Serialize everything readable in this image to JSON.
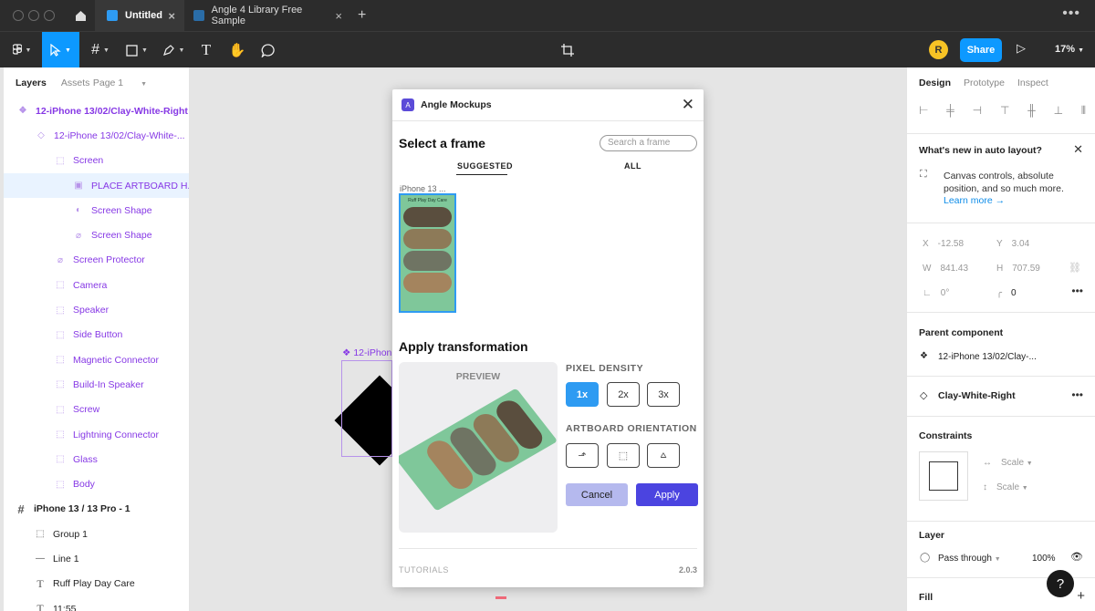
{
  "tabs": [
    {
      "label": "Untitled"
    },
    {
      "label": "Angle 4 Library Free Sample"
    }
  ],
  "toolbar": {
    "avatar": "R",
    "share": "Share",
    "zoom": "17%"
  },
  "left": {
    "tab_layers": "Layers",
    "tab_assets": "Assets",
    "page": "Page 1",
    "layers": [
      "12-iPhone 13/02/Clay-White-Right",
      "12-iPhone 13/02/Clay-White-...",
      "Screen",
      "PLACE ARTBOARD H...",
      "Screen Shape",
      "Screen Shape",
      "Screen Protector",
      "Camera",
      "Speaker",
      "Side Button",
      "Magnetic Connector",
      "Build-In Speaker",
      "Screw",
      "Lightning Connector",
      "Glass",
      "Body",
      "iPhone 13 / 13 Pro - 1",
      "Group 1",
      "Line 1",
      "Ruff Play Day Care",
      "11:55"
    ]
  },
  "canvas": {
    "frame_label": "12-iPhon"
  },
  "modal": {
    "title": "Angle Mockups",
    "select_frame": "Select a frame",
    "search_placeholder": "Search a frame",
    "tab_suggested": "SUGGESTED",
    "tab_all": "ALL",
    "thumb_label": "iPhone 13 ...",
    "thumb_title": "Ruff Play Day Care",
    "apply_transformation": "Apply transformation",
    "preview": "PREVIEW",
    "pixel_density": "PIXEL DENSITY",
    "densities": [
      "1x",
      "2x",
      "3x"
    ],
    "artboard_orientation": "ARTBOARD ORIENTATION",
    "cancel": "Cancel",
    "apply": "Apply",
    "tutorials": "TUTORIALS",
    "version": "2.0.3"
  },
  "right": {
    "tab_design": "Design",
    "tab_prototype": "Prototype",
    "tab_inspect": "Inspect",
    "whats_new_title": "What's new in auto layout?",
    "whats_new_body": "Canvas controls, absolute position, and so much more.",
    "learn_more": "Learn more →",
    "x_label": "X",
    "x": "-12.58",
    "y_label": "Y",
    "y": "3.04",
    "w_label": "W",
    "w": "841.43",
    "h_label": "H",
    "h": "707.59",
    "rotation": "0°",
    "radius": "0",
    "parent_component": "Parent component",
    "parent_name": "12-iPhone 13/02/Clay-...",
    "variant": "Clay-White-Right",
    "constraints": "Constraints",
    "scale_h": "Scale",
    "scale_v": "Scale",
    "layer": "Layer",
    "blend": "Pass through",
    "opacity": "100%",
    "fill": "Fill"
  },
  "help": "?"
}
